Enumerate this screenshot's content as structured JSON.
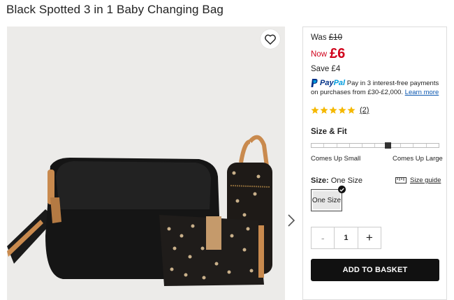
{
  "product": {
    "title": "Black Spotted 3 in 1 Baby Changing Bag"
  },
  "price": {
    "was_label": "Was",
    "was_value": "£10",
    "now_label": "Now",
    "now_value": "£6",
    "save_label": "Save",
    "save_value": "£4",
    "sale_color": "#d0021b"
  },
  "paypal": {
    "brand_pay": "Pay",
    "brand_pal": "Pal",
    "text": "Pay in 3 interest-free payments on purchases from £30-£2,000.",
    "link": "Learn more"
  },
  "rating": {
    "stars": 5,
    "count": "(2)"
  },
  "fit": {
    "heading": "Size & Fit",
    "left_label": "Comes Up Small",
    "right_label": "Comes Up Large",
    "position_fraction": 0.6
  },
  "size": {
    "label": "Size:",
    "value": "One Size",
    "guide_label": "Size guide",
    "options": [
      "One Size"
    ]
  },
  "quantity": {
    "minus": "-",
    "value": "1",
    "plus": "+"
  },
  "cta": {
    "add_to_basket": "ADD TO BASKET"
  },
  "icons": {
    "favourite": "heart-icon",
    "next": "chevron-right-icon",
    "guide": "ruler-icon",
    "selected": "checkmark-icon",
    "star": "star-icon",
    "paypal": "paypal-logo-icon"
  }
}
